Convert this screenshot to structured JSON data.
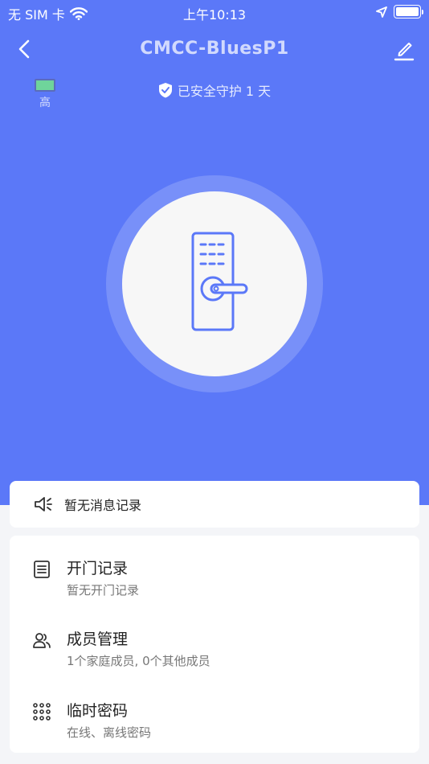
{
  "status_bar": {
    "carrier": "无 SIM 卡",
    "time": "上午10:13"
  },
  "nav": {
    "title": "CMCC-BluesP1"
  },
  "lock_battery": {
    "level_label": "高"
  },
  "guard": {
    "text": "已安全守护 1 天"
  },
  "message": {
    "text": "暂无消息记录"
  },
  "menu": [
    {
      "title": "开门记录",
      "subtitle": "暂无开门记录",
      "icon": "document-list-icon"
    },
    {
      "title": "成员管理",
      "subtitle": "1个家庭成员, 0个其他成员",
      "icon": "members-icon"
    },
    {
      "title": "临时密码",
      "subtitle": "在线、离线密码",
      "icon": "keypad-icon"
    }
  ],
  "colors": {
    "primary": "#5b78f8",
    "icon_blue": "#5b78f8",
    "battery_green": "#6fd49b"
  }
}
